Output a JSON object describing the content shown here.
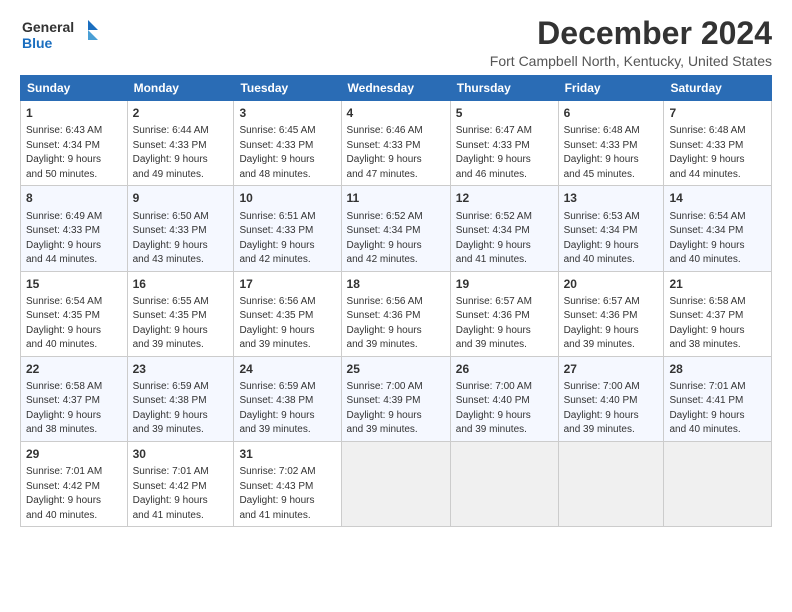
{
  "logo": {
    "line1": "General",
    "line2": "Blue"
  },
  "title": "December 2024",
  "location": "Fort Campbell North, Kentucky, United States",
  "days_header": [
    "Sunday",
    "Monday",
    "Tuesday",
    "Wednesday",
    "Thursday",
    "Friday",
    "Saturday"
  ],
  "weeks": [
    [
      {
        "day": "1",
        "info": "Sunrise: 6:43 AM\nSunset: 4:34 PM\nDaylight: 9 hours\nand 50 minutes."
      },
      {
        "day": "2",
        "info": "Sunrise: 6:44 AM\nSunset: 4:33 PM\nDaylight: 9 hours\nand 49 minutes."
      },
      {
        "day": "3",
        "info": "Sunrise: 6:45 AM\nSunset: 4:33 PM\nDaylight: 9 hours\nand 48 minutes."
      },
      {
        "day": "4",
        "info": "Sunrise: 6:46 AM\nSunset: 4:33 PM\nDaylight: 9 hours\nand 47 minutes."
      },
      {
        "day": "5",
        "info": "Sunrise: 6:47 AM\nSunset: 4:33 PM\nDaylight: 9 hours\nand 46 minutes."
      },
      {
        "day": "6",
        "info": "Sunrise: 6:48 AM\nSunset: 4:33 PM\nDaylight: 9 hours\nand 45 minutes."
      },
      {
        "day": "7",
        "info": "Sunrise: 6:48 AM\nSunset: 4:33 PM\nDaylight: 9 hours\nand 44 minutes."
      }
    ],
    [
      {
        "day": "8",
        "info": "Sunrise: 6:49 AM\nSunset: 4:33 PM\nDaylight: 9 hours\nand 44 minutes."
      },
      {
        "day": "9",
        "info": "Sunrise: 6:50 AM\nSunset: 4:33 PM\nDaylight: 9 hours\nand 43 minutes."
      },
      {
        "day": "10",
        "info": "Sunrise: 6:51 AM\nSunset: 4:33 PM\nDaylight: 9 hours\nand 42 minutes."
      },
      {
        "day": "11",
        "info": "Sunrise: 6:52 AM\nSunset: 4:34 PM\nDaylight: 9 hours\nand 42 minutes."
      },
      {
        "day": "12",
        "info": "Sunrise: 6:52 AM\nSunset: 4:34 PM\nDaylight: 9 hours\nand 41 minutes."
      },
      {
        "day": "13",
        "info": "Sunrise: 6:53 AM\nSunset: 4:34 PM\nDaylight: 9 hours\nand 40 minutes."
      },
      {
        "day": "14",
        "info": "Sunrise: 6:54 AM\nSunset: 4:34 PM\nDaylight: 9 hours\nand 40 minutes."
      }
    ],
    [
      {
        "day": "15",
        "info": "Sunrise: 6:54 AM\nSunset: 4:35 PM\nDaylight: 9 hours\nand 40 minutes."
      },
      {
        "day": "16",
        "info": "Sunrise: 6:55 AM\nSunset: 4:35 PM\nDaylight: 9 hours\nand 39 minutes."
      },
      {
        "day": "17",
        "info": "Sunrise: 6:56 AM\nSunset: 4:35 PM\nDaylight: 9 hours\nand 39 minutes."
      },
      {
        "day": "18",
        "info": "Sunrise: 6:56 AM\nSunset: 4:36 PM\nDaylight: 9 hours\nand 39 minutes."
      },
      {
        "day": "19",
        "info": "Sunrise: 6:57 AM\nSunset: 4:36 PM\nDaylight: 9 hours\nand 39 minutes."
      },
      {
        "day": "20",
        "info": "Sunrise: 6:57 AM\nSunset: 4:36 PM\nDaylight: 9 hours\nand 39 minutes."
      },
      {
        "day": "21",
        "info": "Sunrise: 6:58 AM\nSunset: 4:37 PM\nDaylight: 9 hours\nand 38 minutes."
      }
    ],
    [
      {
        "day": "22",
        "info": "Sunrise: 6:58 AM\nSunset: 4:37 PM\nDaylight: 9 hours\nand 38 minutes."
      },
      {
        "day": "23",
        "info": "Sunrise: 6:59 AM\nSunset: 4:38 PM\nDaylight: 9 hours\nand 39 minutes."
      },
      {
        "day": "24",
        "info": "Sunrise: 6:59 AM\nSunset: 4:38 PM\nDaylight: 9 hours\nand 39 minutes."
      },
      {
        "day": "25",
        "info": "Sunrise: 7:00 AM\nSunset: 4:39 PM\nDaylight: 9 hours\nand 39 minutes."
      },
      {
        "day": "26",
        "info": "Sunrise: 7:00 AM\nSunset: 4:40 PM\nDaylight: 9 hours\nand 39 minutes."
      },
      {
        "day": "27",
        "info": "Sunrise: 7:00 AM\nSunset: 4:40 PM\nDaylight: 9 hours\nand 39 minutes."
      },
      {
        "day": "28",
        "info": "Sunrise: 7:01 AM\nSunset: 4:41 PM\nDaylight: 9 hours\nand 40 minutes."
      }
    ],
    [
      {
        "day": "29",
        "info": "Sunrise: 7:01 AM\nSunset: 4:42 PM\nDaylight: 9 hours\nand 40 minutes."
      },
      {
        "day": "30",
        "info": "Sunrise: 7:01 AM\nSunset: 4:42 PM\nDaylight: 9 hours\nand 41 minutes."
      },
      {
        "day": "31",
        "info": "Sunrise: 7:02 AM\nSunset: 4:43 PM\nDaylight: 9 hours\nand 41 minutes."
      },
      null,
      null,
      null,
      null
    ]
  ]
}
